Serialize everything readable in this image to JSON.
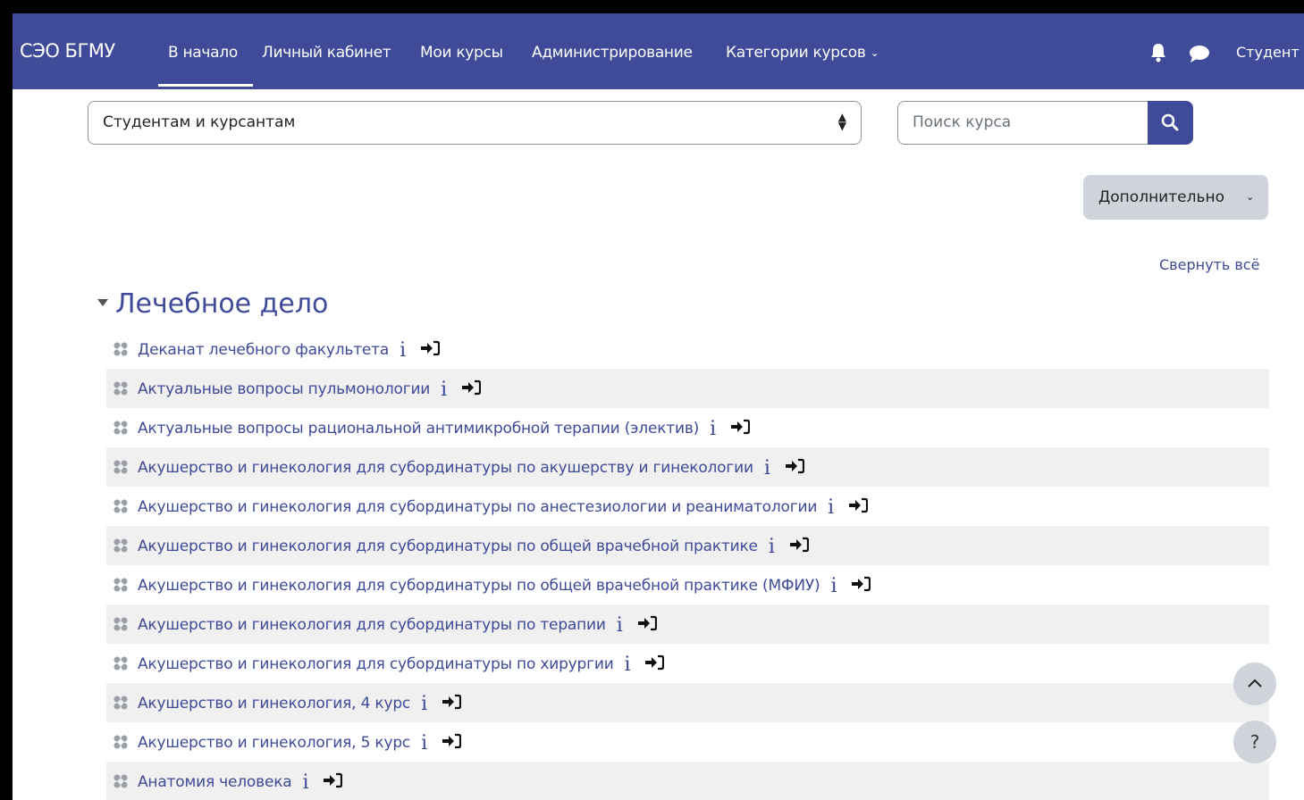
{
  "navbar": {
    "brand": "СЭО БГМУ",
    "items": [
      {
        "label": "В начало"
      },
      {
        "label": "Личный кабинет"
      },
      {
        "label": "Мои курсы"
      },
      {
        "label": "Администрирование"
      },
      {
        "label": "Категории курсов"
      }
    ],
    "user_label": "Студент",
    "icons": [
      "bell-icon",
      "chat-icon"
    ],
    "background_color": "#3f4a99"
  },
  "filters": {
    "category_select_value": "Студентам и курсантам",
    "search_placeholder": "Поиск курса"
  },
  "actions": {
    "more_label": "Дополнительно",
    "collapse_all_label": "Свернуть всё"
  },
  "category": {
    "title": "Лечебное дело",
    "courses": [
      {
        "name": "Деканат лечебного факультета"
      },
      {
        "name": "Актуальные вопросы пульмонологии"
      },
      {
        "name": "Актуальные вопросы рациональной антимикробной терапии (электив)"
      },
      {
        "name": "Акушерство и гинекология для субординатуры по акушерству и гинекологии"
      },
      {
        "name": "Акушерство и гинекология для субординатуры по анестезиологии и реаниматологии"
      },
      {
        "name": "Акушерство и гинекология для субординатуры по общей врачебной практике"
      },
      {
        "name": "Акушерство и гинекология для субординатуры по общей врачебной практике (МФИУ)"
      },
      {
        "name": "Акушерство и гинекология для субординатуры по терапии"
      },
      {
        "name": "Акушерство и гинекология для субординатуры по хирургии"
      },
      {
        "name": "Акушерство и гинекология, 4 курс"
      },
      {
        "name": "Акушерство и гинекология, 5 курс"
      },
      {
        "name": "Анатомия человека"
      }
    ]
  },
  "floating": {
    "help_label": "?"
  },
  "colors": {
    "accent": "#3f4a99",
    "row_alt": "#f0f0f0",
    "button_gray": "#ced4da"
  }
}
